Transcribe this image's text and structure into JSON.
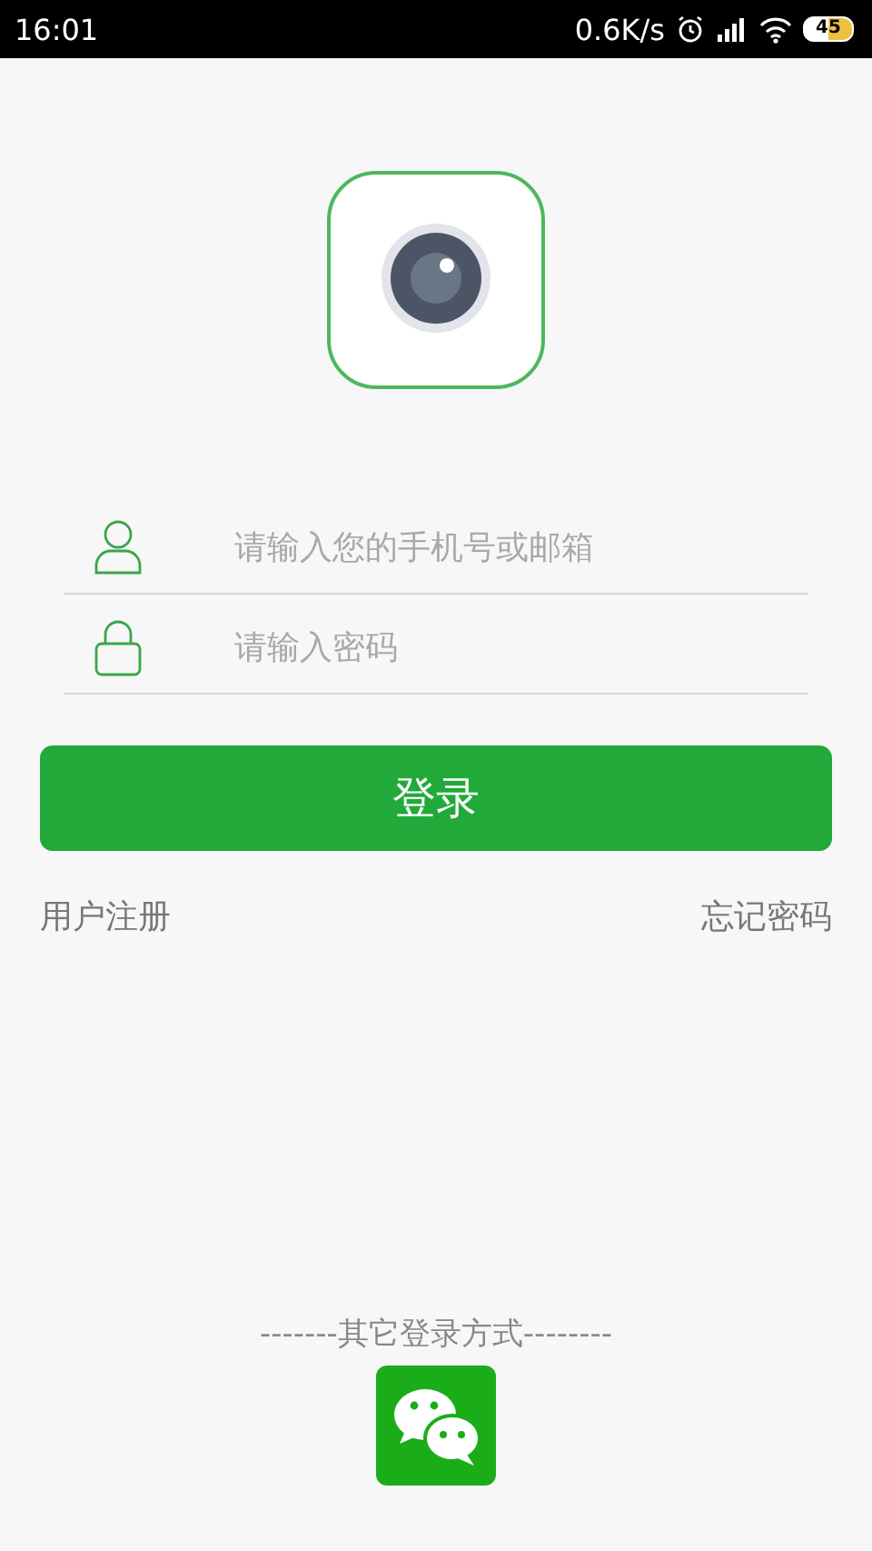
{
  "status_bar": {
    "time": "16:01",
    "speed": "0.6K/s",
    "battery": "45"
  },
  "form": {
    "account": {
      "placeholder": "请输入您的手机号或邮箱"
    },
    "password": {
      "placeholder": "请输入密码"
    },
    "login_button": "登录"
  },
  "links": {
    "register": "用户注册",
    "forgot": "忘记密码"
  },
  "other_login": {
    "label": "-------其它登录方式--------"
  }
}
